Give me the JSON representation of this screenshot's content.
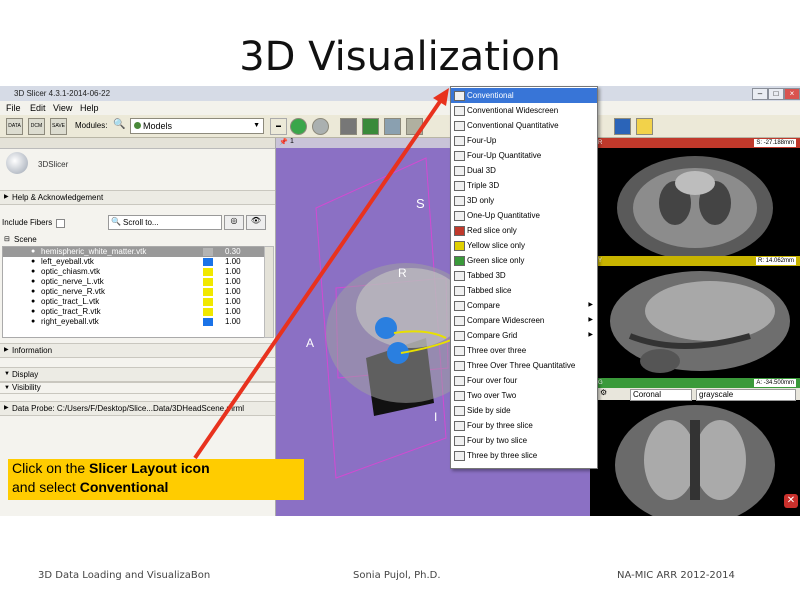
{
  "slide": {
    "title": "3D Visualization",
    "footer_left": "3D Data Loading and VisualizaBon",
    "footer_center": "Sonia Pujol, Ph.D.",
    "footer_right": "NA-MIC ARR 2012-2014"
  },
  "window": {
    "title": "3D Slicer 4.3.1-2014-06-22",
    "menu": [
      "File",
      "Edit",
      "View",
      "Help"
    ]
  },
  "toolbar": {
    "modules_label": "Modules:",
    "modules_value": "Models",
    "buttons": [
      "DATA",
      "DCM",
      "SAVE"
    ]
  },
  "left_panel": {
    "logo_text": "3DSlicer",
    "help_section": "Help & Acknowledgement",
    "include_fibers": "Include Fibers",
    "scroll_to": "Scroll to...",
    "scene_label": "Scene",
    "models": [
      {
        "name": "hemispheric_white_matter.vtk",
        "opacity": "0.30",
        "color": "#b4b4b4"
      },
      {
        "name": "left_eyeball.vtk",
        "opacity": "1.00",
        "color": "#1a73e8"
      },
      {
        "name": "optic_chiasm.vtk",
        "opacity": "1.00",
        "color": "#f0e800"
      },
      {
        "name": "optic_nerve_L.vtk",
        "opacity": "1.00",
        "color": "#f0e800"
      },
      {
        "name": "optic_nerve_R.vtk",
        "opacity": "1.00",
        "color": "#f0e800"
      },
      {
        "name": "optic_tract_L.vtk",
        "opacity": "1.00",
        "color": "#f0e800"
      },
      {
        "name": "optic_tract_R.vtk",
        "opacity": "1.00",
        "color": "#f0e800"
      },
      {
        "name": "right_eyeball.vtk",
        "opacity": "1.00",
        "color": "#1a73e8"
      }
    ],
    "information_section": "Information",
    "display_section": "Display",
    "visibility_label": "Visibility",
    "data_probe": "Data Probe: C:/Users/F/Desktop/Slice...Data/3DHeadScene.mrml"
  },
  "viewer3d": {
    "label": "1",
    "orientation_s": "S",
    "orientation_r": "R",
    "orientation_a": "A",
    "orientation_i": "I"
  },
  "slice_views": {
    "red_value": "S: -27.188mm",
    "yellow_value": "R: 14.062mm",
    "green_value": "A: -34.500mm",
    "orientation": "Coronal",
    "colormap": "grayscale",
    "red_label": "R",
    "yellow_label": "Y",
    "green_label": "G"
  },
  "layout_menu": {
    "items": [
      {
        "label": "Conventional",
        "selected": true,
        "submenu": false
      },
      {
        "label": "Conventional Widescreen",
        "selected": false,
        "submenu": false
      },
      {
        "label": "Conventional Quantitative",
        "selected": false,
        "submenu": false
      },
      {
        "label": "Four-Up",
        "selected": false,
        "submenu": false
      },
      {
        "label": "Four-Up Quantitative",
        "selected": false,
        "submenu": false
      },
      {
        "label": "Dual 3D",
        "selected": false,
        "submenu": false
      },
      {
        "label": "Triple 3D",
        "selected": false,
        "submenu": false
      },
      {
        "label": "3D only",
        "selected": false,
        "submenu": false
      },
      {
        "label": "One-Up Quantitative",
        "selected": false,
        "submenu": false
      },
      {
        "label": "Red slice only",
        "selected": false,
        "submenu": false
      },
      {
        "label": "Yellow slice only",
        "selected": false,
        "submenu": false
      },
      {
        "label": "Green slice only",
        "selected": false,
        "submenu": false
      },
      {
        "label": "Tabbed 3D",
        "selected": false,
        "submenu": false
      },
      {
        "label": "Tabbed slice",
        "selected": false,
        "submenu": false
      },
      {
        "label": "Compare",
        "selected": false,
        "submenu": true
      },
      {
        "label": "Compare Widescreen",
        "selected": false,
        "submenu": true
      },
      {
        "label": "Compare Grid",
        "selected": false,
        "submenu": true
      },
      {
        "label": "Three over three",
        "selected": false,
        "submenu": false
      },
      {
        "label": "Three Over Three Quantitative",
        "selected": false,
        "submenu": false
      },
      {
        "label": "Four over four",
        "selected": false,
        "submenu": false
      },
      {
        "label": "Two over Two",
        "selected": false,
        "submenu": false
      },
      {
        "label": "Side by side",
        "selected": false,
        "submenu": false
      },
      {
        "label": "Four by three slice",
        "selected": false,
        "submenu": false
      },
      {
        "label": "Four by two slice",
        "selected": false,
        "submenu": false
      },
      {
        "label": "Three by three slice",
        "selected": false,
        "submenu": false
      }
    ]
  },
  "callout": {
    "line1_prefix": "Click on the ",
    "line1_bold": "Slicer Layout icon",
    "line2_prefix": "and select ",
    "line2_bold": "Conventional"
  },
  "colors": {
    "callout_bg": "#ffcc00",
    "arrow": "#e8321e",
    "viewer_bg": "#8b70c4",
    "red_bar": "#c0392b",
    "yellow_bar": "#c8b400",
    "green_bar": "#3a9a3a",
    "selection": "#3875d7"
  }
}
